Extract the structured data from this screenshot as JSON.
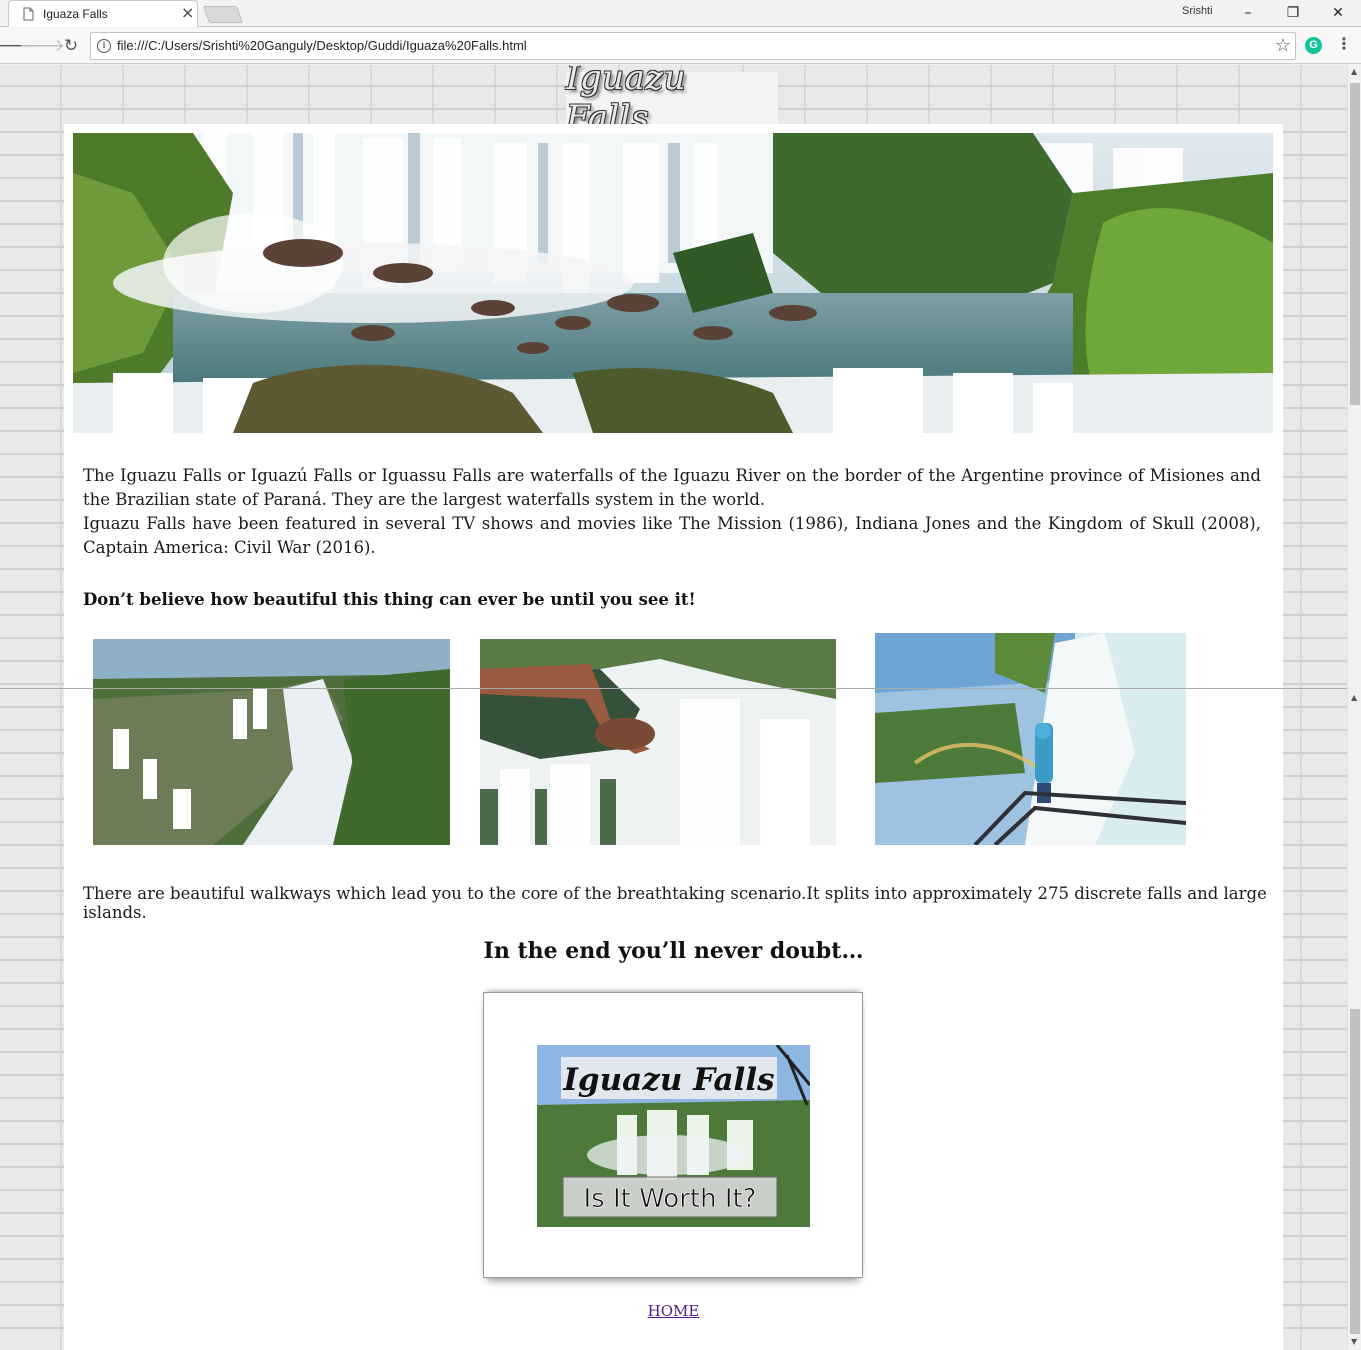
{
  "browser": {
    "tab_title": "Iguaza Falls",
    "tab_close": "×",
    "profile_name": "Srishti",
    "url": "file:///C:/Users/Srishti%20Ganguly/Desktop/Guddi/Iguaza%20Falls.html",
    "ext_letter": "G",
    "minimize": "–",
    "maximize": "❐",
    "close": "✕"
  },
  "page": {
    "title": "Iguazu Falls",
    "intro_1": "The Iguazu Falls or Iguazú Falls or Iguassu Falls are waterfalls of the Iguazu River on the border of the Argentine province of Misiones and the Brazilian state of Paraná. They are the largest waterfalls system in the world.",
    "intro_2": "Iguazu Falls have been featured in several TV shows and movies like The Mission (1986), Indiana Jones and the Kingdom of Skull (2008), Captain America: Civil War (2016).",
    "tagline": "Don’t believe how beautiful this thing can ever be until you see it!",
    "walkways": "There are beautiful walkways which lead you to the core of the breathtaking scenario.It splits into approximately 275 discrete falls and large islands.",
    "end_heading": "In the end you’ll never doubt…",
    "poster_title": "Iguazu Falls",
    "poster_caption": "Is It Worth It?",
    "home_link": "HOME"
  }
}
